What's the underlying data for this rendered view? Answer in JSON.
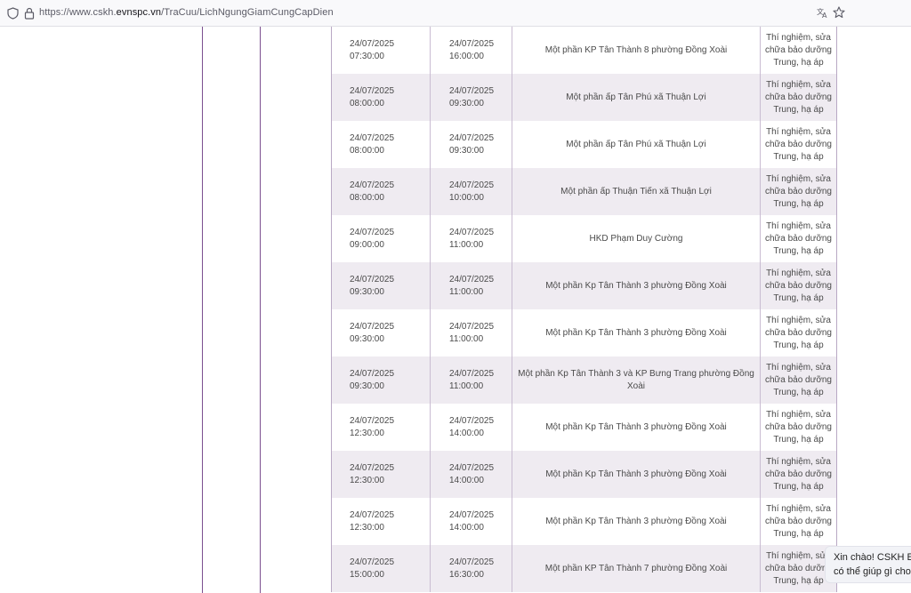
{
  "browser": {
    "url_prefix": "https://www.cskh.",
    "url_host": "evnspc.vn",
    "url_path": "/TraCuu/LichNgungGiamCungCapDien"
  },
  "schedule": {
    "rows": [
      {
        "start_date": "24/07/2025",
        "start_time": "07:30:00",
        "end_date": "24/07/2025",
        "end_time": "16:00:00",
        "area": "Một phần KP Tân Thành 8 phường Đồng Xoài",
        "reason": "Thí nghiệm, sửa chữa bảo dưỡng Trung, hạ áp"
      },
      {
        "start_date": "24/07/2025",
        "start_time": "08:00:00",
        "end_date": "24/07/2025",
        "end_time": "09:30:00",
        "area": "Một phần ấp Tân Phú xã Thuận Lợi",
        "reason": "Thí nghiệm, sửa chữa bảo dưỡng Trung, hạ áp"
      },
      {
        "start_date": "24/07/2025",
        "start_time": "08:00:00",
        "end_date": "24/07/2025",
        "end_time": "09:30:00",
        "area": "Một phần ấp Tân Phú xã Thuận Lợi",
        "reason": "Thí nghiệm, sửa chữa bảo dưỡng Trung, hạ áp"
      },
      {
        "start_date": "24/07/2025",
        "start_time": "08:00:00",
        "end_date": "24/07/2025",
        "end_time": "10:00:00",
        "area": "Một phần ấp Thuận Tiến xã Thuận Lợi",
        "reason": "Thí nghiệm, sửa chữa bảo dưỡng Trung, hạ áp"
      },
      {
        "start_date": "24/07/2025",
        "start_time": "09:00:00",
        "end_date": "24/07/2025",
        "end_time": "11:00:00",
        "area": "HKD Phạm Duy Cường",
        "reason": "Thí nghiệm, sửa chữa bảo dưỡng Trung, hạ áp"
      },
      {
        "start_date": "24/07/2025",
        "start_time": "09:30:00",
        "end_date": "24/07/2025",
        "end_time": "11:00:00",
        "area": "Một phần Kp Tân Thành 3 phường Đồng Xoài",
        "reason": "Thí nghiệm, sửa chữa bảo dưỡng Trung, hạ áp"
      },
      {
        "start_date": "24/07/2025",
        "start_time": "09:30:00",
        "end_date": "24/07/2025",
        "end_time": "11:00:00",
        "area": "Một phần Kp Tân Thành 3 phường Đồng Xoài",
        "reason": "Thí nghiệm, sửa chữa bảo dưỡng Trung, hạ áp"
      },
      {
        "start_date": "24/07/2025",
        "start_time": "09:30:00",
        "end_date": "24/07/2025",
        "end_time": "11:00:00",
        "area": "Một phần Kp Tân Thành 3 và KP Bưng Trang phường Đồng Xoài",
        "reason": "Thí nghiệm, sửa chữa bảo dưỡng Trung, hạ áp"
      },
      {
        "start_date": "24/07/2025",
        "start_time": "12:30:00",
        "end_date": "24/07/2025",
        "end_time": "14:00:00",
        "area": "Một phần Kp Tân Thành 3 phường Đồng Xoài",
        "reason": "Thí nghiệm, sửa chữa bảo dưỡng Trung, hạ áp"
      },
      {
        "start_date": "24/07/2025",
        "start_time": "12:30:00",
        "end_date": "24/07/2025",
        "end_time": "14:00:00",
        "area": "Một phần Kp Tân Thành 3 phường Đồng Xoài",
        "reason": "Thí nghiệm, sửa chữa bảo dưỡng Trung, hạ áp"
      },
      {
        "start_date": "24/07/2025",
        "start_time": "12:30:00",
        "end_date": "24/07/2025",
        "end_time": "14:00:00",
        "area": "Một phần Kp Tân Thành 3 phường Đồng Xoài",
        "reason": "Thí nghiệm, sửa chữa bảo dưỡng Trung, hạ áp"
      },
      {
        "start_date": "24/07/2025",
        "start_time": "15:00:00",
        "end_date": "24/07/2025",
        "end_time": "16:30:00",
        "area": "Một phần KP Tân Thành 7 phường Đồng Xoài",
        "reason": "Thí nghiệm, sửa chữa bảo dưỡng Trung, hạ áp"
      }
    ]
  },
  "chat": {
    "line1": "Xin chào! CSKH E",
    "line2": "có thể giúp gì cho"
  },
  "icons": {
    "shield": "shield-icon",
    "lock": "lock-icon",
    "translate": "translate-icon",
    "bookmark": "bookmark-star-icon"
  },
  "colors": {
    "accent_line": "#7b4f8f",
    "row_alt": "#efebf1"
  }
}
